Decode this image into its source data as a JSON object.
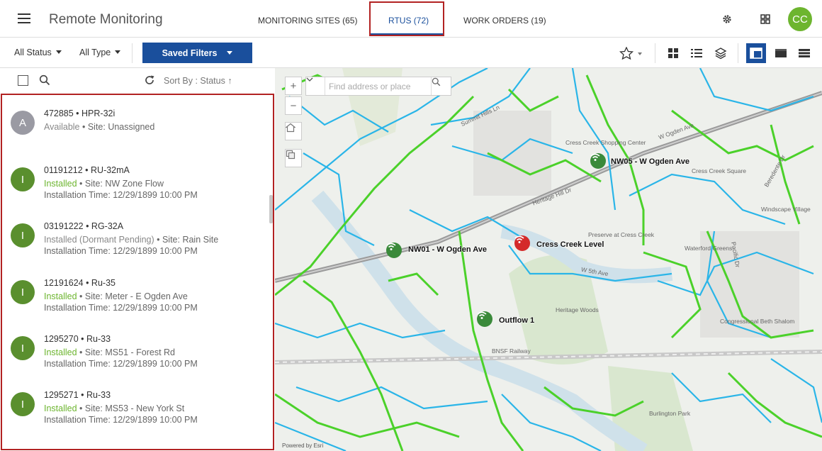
{
  "app": {
    "title": "Remote Monitoring",
    "user_initials": "CC"
  },
  "nav": {
    "tabs": [
      {
        "label": "MONITORING SITES (65)"
      },
      {
        "label": "RTUS (72)"
      },
      {
        "label": "WORK ORDERS (19)"
      }
    ]
  },
  "toolbar": {
    "status_filter": "All Status",
    "type_filter": "All Type",
    "saved_filters": "Saved Filters"
  },
  "list_header": {
    "sort_label": "Sort By : Status"
  },
  "rtus": [
    {
      "initial": "A",
      "title": "472885 • HPR-32i",
      "status": "Available",
      "site": " • Site: Unassigned",
      "install": "",
      "color": "#9a9aa3",
      "status_color": "#888888"
    },
    {
      "initial": "I",
      "title": "01191212 • RU-32mA",
      "status": "Installed",
      "site": " • Site: NW Zone Flow",
      "install": "Installation Time: 12/29/1899 10:00 PM",
      "color": "#5a8f2e",
      "status_color": "#6db52f"
    },
    {
      "initial": "I",
      "title": "03191222 • RG-32A",
      "status": "Installed (Dormant Pending)",
      "site": " • Site: Rain Site",
      "install": "Installation Time: 12/29/1899 10:00 PM",
      "color": "#5a8f2e",
      "status_color": "#888888"
    },
    {
      "initial": "I",
      "title": "12191624 • Ru-35",
      "status": "Installed",
      "site": " • Site: Meter - E Ogden Ave",
      "install": "Installation Time: 12/29/1899 10:00 PM",
      "color": "#5a8f2e",
      "status_color": "#6db52f"
    },
    {
      "initial": "I",
      "title": "1295270 • Ru-33",
      "status": "Installed",
      "site": " • Site: MS51 - Forest Rd",
      "install": "Installation Time: 12/29/1899 10:00 PM",
      "color": "#5a8f2e",
      "status_color": "#6db52f"
    },
    {
      "initial": "I",
      "title": "1295271 • Ru-33",
      "status": "Installed",
      "site": " • Site: MS53 - New York St",
      "install": "Installation Time: 12/29/1899 10:00 PM",
      "color": "#5a8f2e",
      "status_color": "#6db52f"
    }
  ],
  "map": {
    "search_placeholder": "Find address or place",
    "attribution": "Powered by Esri",
    "sites": [
      {
        "label": "NW05 - W Ogden Ave",
        "color": "#3a8a3a"
      },
      {
        "label": "NW01 - W Ogden Ave",
        "color": "#3a8a3a"
      },
      {
        "label": "Cress Creek Level",
        "color": "#d42a2a"
      },
      {
        "label": "Outflow 1",
        "color": "#3a8a3a"
      }
    ],
    "places": [
      "Cress Creek Shopping Center",
      "Cress Creek Square",
      "Windscape Village",
      "Preserve at Cress Creek",
      "Waterford Greens",
      "Heritage Woods",
      "Congressional Beth Shalom",
      "Burlington Park"
    ],
    "streets": [
      "W Ogden Ave",
      "Heritage Hill Dr",
      "W 5th Ave",
      "BNSF Railway",
      "Summit Hills Ln",
      "Pacific Dr",
      "Beredente Dr"
    ]
  }
}
